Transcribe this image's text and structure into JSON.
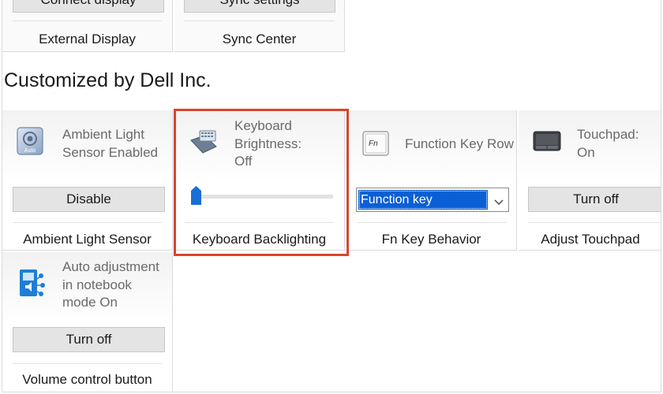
{
  "top_row": [
    {
      "button": "Connect display",
      "footer": "External Display"
    },
    {
      "button": "Sync settings",
      "footer": "Sync Center"
    }
  ],
  "section_title": "Customized by Dell Inc.",
  "tiles": {
    "ambient": {
      "status_lines": [
        "Ambient Light",
        "Sensor Enabled"
      ],
      "icon_caption": "Auto",
      "button": "Disable",
      "footer": "Ambient Light Sensor"
    },
    "keyboard": {
      "status_lines": [
        "Keyboard",
        "Brightness:",
        "Off"
      ],
      "slider_level": 0,
      "footer": "Keyboard Backlighting"
    },
    "fnkey": {
      "icon_label": "Fn",
      "status": "Function Key Row",
      "select_value": "Function key",
      "footer": "Fn Key Behavior"
    },
    "touchpad": {
      "status_lines": [
        "Touchpad:",
        "On"
      ],
      "button": "Turn off",
      "footer": "Adjust Touchpad"
    },
    "volume": {
      "status_lines": [
        "Auto adjustment",
        "in notebook",
        "mode On"
      ],
      "button": "Turn off",
      "footer": "Volume control button"
    }
  },
  "colors": {
    "highlight_border": "#d9442f",
    "select_highlight": "#0b5fd4",
    "slider_thumb": "#1a6fd6"
  }
}
